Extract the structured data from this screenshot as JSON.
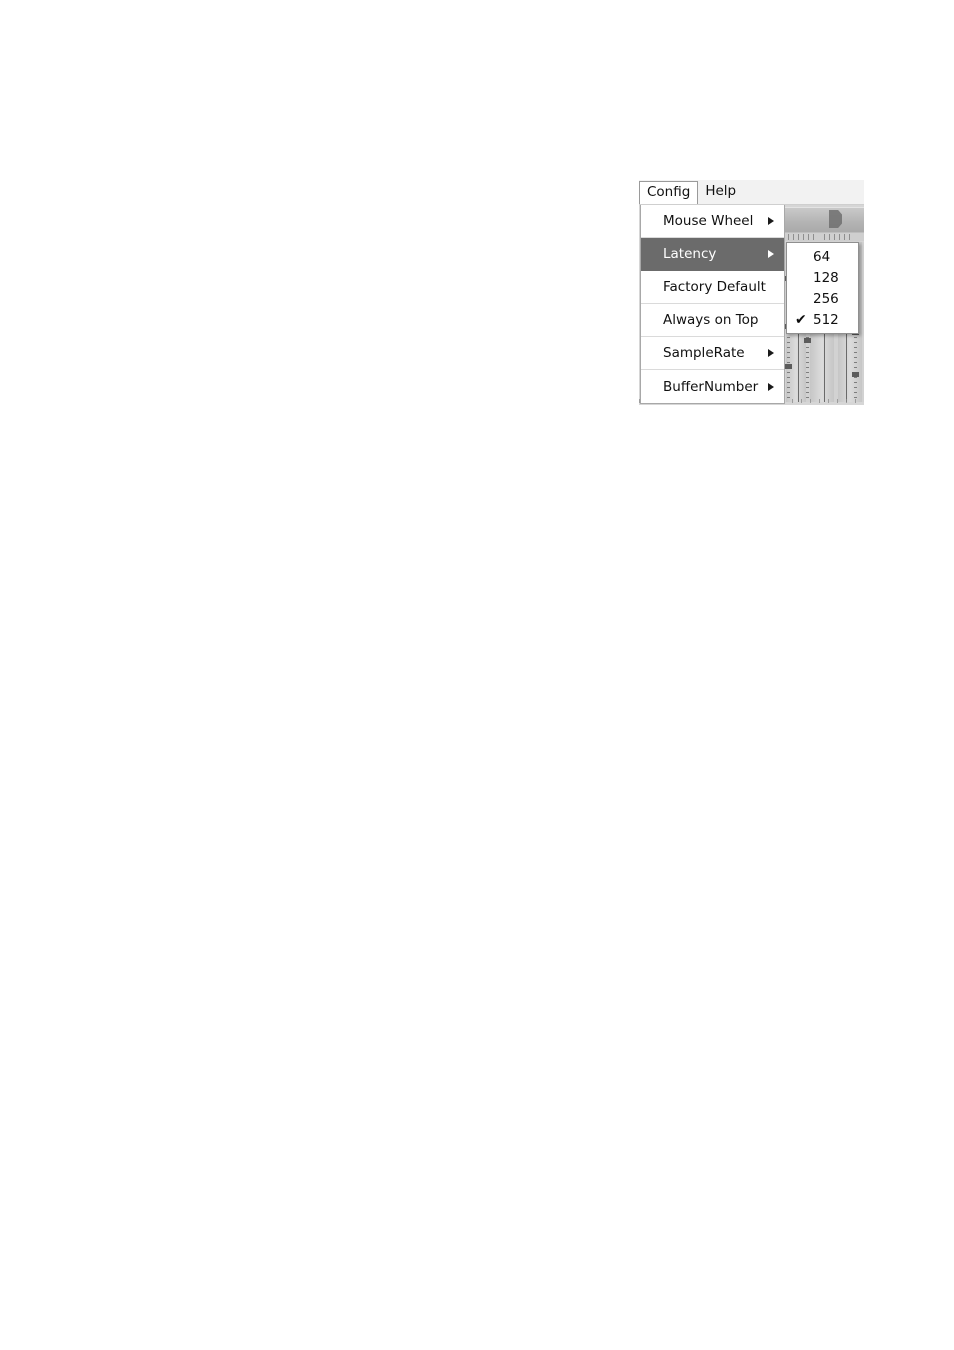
{
  "app": {
    "menubar": {
      "items": [
        {
          "label": "Config",
          "state": "open"
        },
        {
          "label": "Help",
          "state": "closed"
        }
      ]
    },
    "config_menu": {
      "items": [
        {
          "label": "Mouse Wheel",
          "has_submenu": true,
          "highlighted": false
        },
        {
          "label": "Latency",
          "has_submenu": true,
          "highlighted": true
        },
        {
          "label": "Factory Default",
          "has_submenu": false,
          "highlighted": false
        },
        {
          "label": "Always on Top",
          "has_submenu": false,
          "highlighted": false
        },
        {
          "label": "SampleRate",
          "has_submenu": true,
          "highlighted": false
        },
        {
          "label": "BufferNumber",
          "has_submenu": true,
          "highlighted": false
        }
      ]
    },
    "latency_submenu": {
      "items": [
        {
          "label": "64",
          "checked": false
        },
        {
          "label": "128",
          "checked": false
        },
        {
          "label": "256",
          "checked": false
        },
        {
          "label": "512",
          "checked": true
        }
      ],
      "check_glyph": "✔",
      "selected_value": "512"
    },
    "colors": {
      "menu_background": "#ffffff",
      "menubar_background": "#f2f2f2",
      "highlight_background": "#6b6b6b",
      "highlight_text": "#ffffff",
      "text": "#111111",
      "window_chrome": "#d6d6d6",
      "separator": "#dadada"
    }
  }
}
